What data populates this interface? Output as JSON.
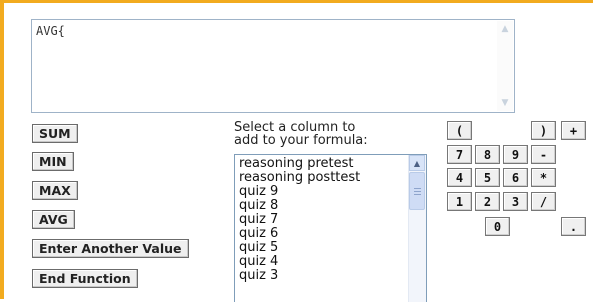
{
  "formula": {
    "value": "AVG{"
  },
  "functions": {
    "sum": "SUM",
    "min": "MIN",
    "max": "MAX",
    "avg": "AVG",
    "enter_value": "Enter Another Value",
    "end_function": "End Function"
  },
  "column_select": {
    "label_line1": "Select a column to",
    "label_line2": "add to your formula:",
    "items": [
      "reasoning pretest",
      "reasoning posttest",
      "quiz 9",
      "quiz 8",
      "quiz 7",
      "quiz 6",
      "quiz 5",
      "quiz 4",
      "quiz 3"
    ]
  },
  "keypad": {
    "open_paren": "(",
    "close_paren": ")",
    "plus": "+",
    "seven": "7",
    "eight": "8",
    "nine": "9",
    "minus": "-",
    "four": "4",
    "five": "5",
    "six": "6",
    "multiply": "*",
    "one": "1",
    "two": "2",
    "three": "3",
    "divide": "/",
    "zero": "0",
    "decimal": "."
  },
  "icons": {
    "scroll_up": "chevron-up-icon",
    "scroll_down": "chevron-down-icon"
  },
  "colors": {
    "panel_border": "#f2ab1f"
  }
}
